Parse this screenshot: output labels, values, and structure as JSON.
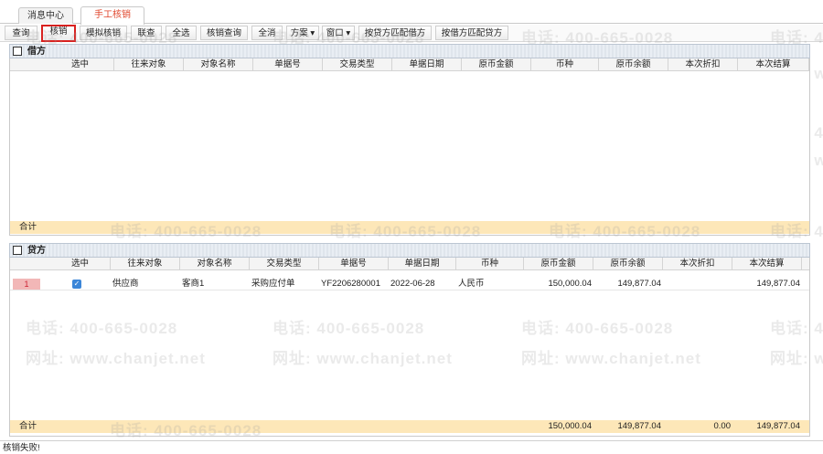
{
  "tabs": [
    {
      "label": "消息中心"
    },
    {
      "label": "手工核销"
    }
  ],
  "toolbar": {
    "query": "查询",
    "verify": "核销",
    "simulate_verify": "模拟核销",
    "joint_query": "联查",
    "select_all": "全选",
    "verify_query": "核销查询",
    "deselect_all": "全消",
    "scheme": "方案",
    "window": "窗口",
    "match_by_credit": "按贷方匹配借方",
    "match_by_debit": "按借方匹配贷方"
  },
  "debit": {
    "title": "借方",
    "columns": [
      "选中",
      "往来对象",
      "对象名称",
      "单据号",
      "交易类型",
      "单据日期",
      "原币金额",
      "币种",
      "原币余额",
      "本次折扣",
      "本次结算"
    ],
    "total_label": "合计"
  },
  "credit": {
    "title": "贷方",
    "columns": [
      "选中",
      "往来对象",
      "对象名称",
      "交易类型",
      "单据号",
      "单据日期",
      "币种",
      "原币金额",
      "原币余额",
      "本次折扣",
      "本次结算"
    ],
    "rows": [
      {
        "num": "1",
        "selected": true,
        "partner": "供应商",
        "name": "客商1",
        "trans_type": "采购应付单",
        "doc_no": "YF2206280001",
        "date": "2022-06-28",
        "currency": "人民币",
        "amount": "150,000.04",
        "balance": "149,877.04",
        "discount": "",
        "settle": "149,877.04"
      }
    ],
    "total_label": "合计",
    "totals": {
      "amount": "150,000.04",
      "balance": "149,877.04",
      "discount": "0.00",
      "settle": "149,877.04"
    }
  },
  "watermark": {
    "phone": "电话: 400-665-0028",
    "site": "网址: www.chanjet.net"
  },
  "status": "核销失败!"
}
